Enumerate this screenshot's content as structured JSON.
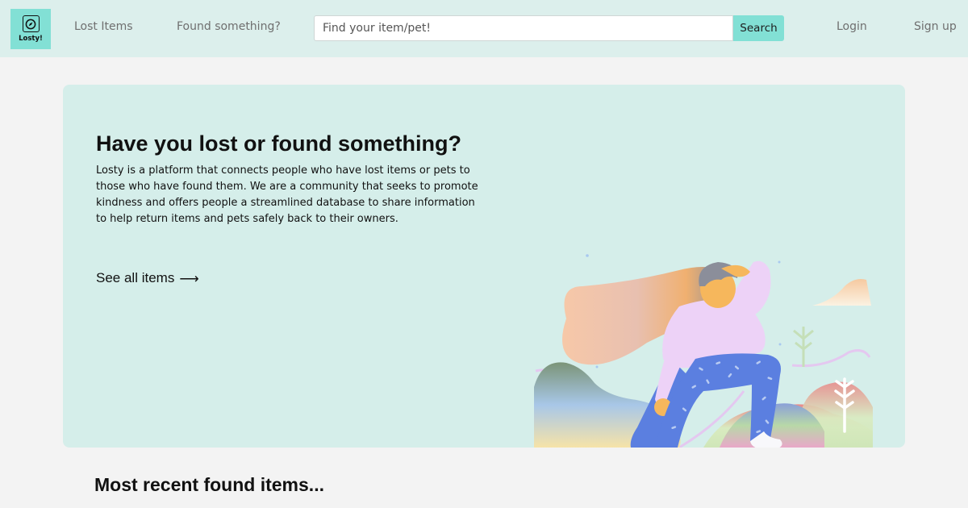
{
  "brand": {
    "name": "Losty!",
    "icon": "compass-icon",
    "accent": "#82e0d5"
  },
  "nav": {
    "lost_items": "Lost Items",
    "found_something": "Found something?",
    "login": "Login",
    "signup": "Sign up"
  },
  "search": {
    "placeholder": "Find your item/pet!",
    "value": "",
    "button_label": "Search"
  },
  "hero": {
    "title": "Have you lost or found something?",
    "description": "Losty is a platform that connects people who have lost items or pets to those who have found them. We are a community that seeks to promote kindness and offers people a streamlined database to share information to help return items and pets safely back to their owners.",
    "cta_label": "See all items",
    "cta_icon": "arrow-right-icon",
    "illustration": "person-searching-illustration"
  },
  "sections": {
    "recent_found_title": "Most recent found items..."
  },
  "colors": {
    "navbar_bg": "#dcefec",
    "hero_bg": "#d5eeea",
    "page_bg": "#f3f3f3"
  }
}
